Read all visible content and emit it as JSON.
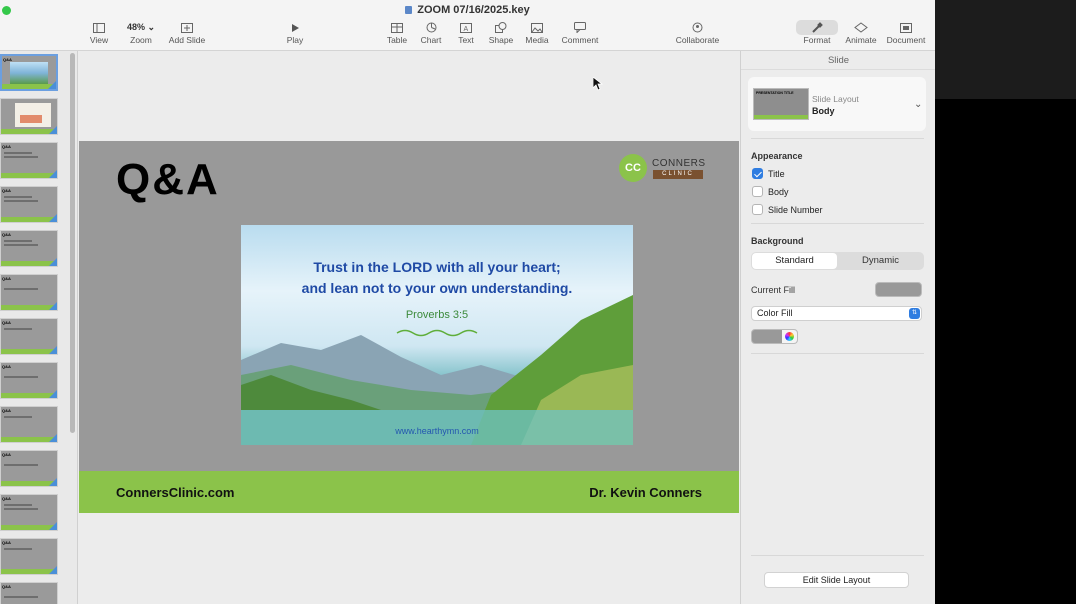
{
  "window": {
    "title": "ZOOM 07/16/2025.key"
  },
  "toolbar": {
    "view": "View",
    "zoom_value": "48%",
    "zoom": "Zoom",
    "add_slide": "Add Slide",
    "play": "Play",
    "table": "Table",
    "chart": "Chart",
    "text": "Text",
    "shape": "Shape",
    "media": "Media",
    "comment": "Comment",
    "collaborate": "Collaborate",
    "format": "Format",
    "animate": "Animate",
    "document": "Document"
  },
  "slide": {
    "title": "Q&A",
    "logo": {
      "mark": "CC",
      "line1": "CONNERS",
      "line2": "CLINIC"
    },
    "verse_line1": "Trust in the LORD with all your heart;",
    "verse_line2": "and lean not to your own understanding.",
    "verse_ref": "Proverbs 3:5",
    "image_url": "www.hearthymn.com",
    "footer_left": "ConnersClinic.com",
    "footer_right": "Dr. Kevin Conners"
  },
  "inspector": {
    "header": "Slide",
    "layout_label": "Slide Layout",
    "layout_value": "Body",
    "layout_thumb_text": "PRESENTATION TITLE",
    "appearance": "Appearance",
    "title_opt": "Title",
    "body_opt": "Body",
    "slide_number_opt": "Slide Number",
    "background": "Background",
    "standard": "Standard",
    "dynamic": "Dynamic",
    "current_fill": "Current Fill",
    "fill_type": "Color Fill",
    "edit_layout": "Edit Slide Layout"
  },
  "colors": {
    "accent": "#2f7de1",
    "slide_bg": "#999999",
    "footer_green": "#8bc34a"
  },
  "navigator": {
    "thumb_title": "Q&A"
  }
}
